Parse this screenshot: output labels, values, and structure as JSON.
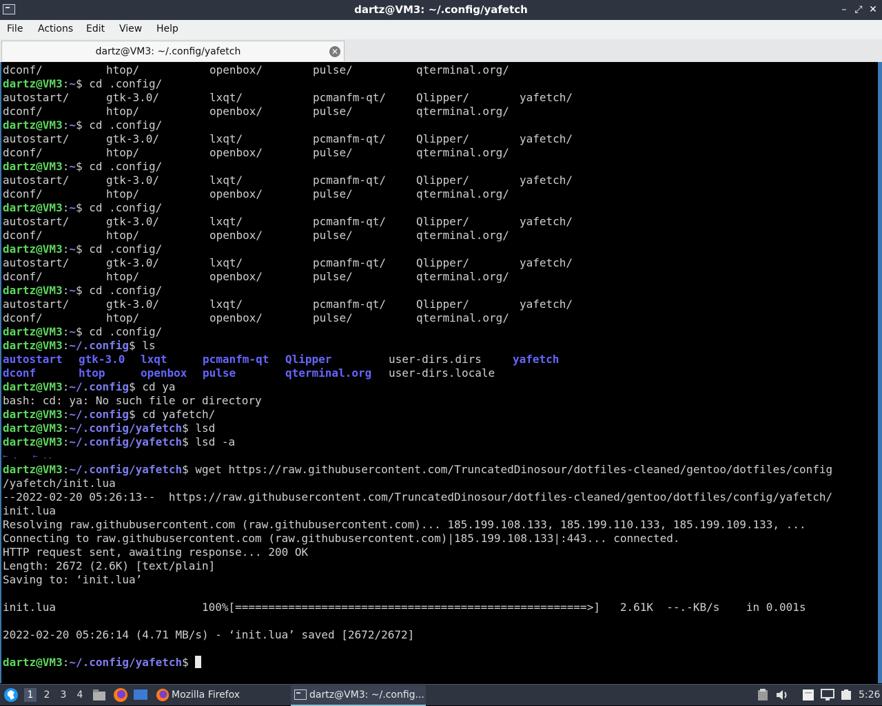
{
  "window": {
    "title": "dartz@VM3: ~/.config/yafetch"
  },
  "menu": [
    "File",
    "Actions",
    "Edit",
    "View",
    "Help"
  ],
  "tab": {
    "label": "dartz@VM3: ~/.config/yafetch"
  },
  "prompts": {
    "home": [
      "dartz@VM3",
      ":",
      "~",
      "$"
    ],
    "config": [
      "dartz@VM3",
      ":",
      "~/.config",
      "$"
    ],
    "yafetch": [
      "dartz@VM3",
      ":",
      "~/.config/yafetch",
      "$"
    ]
  },
  "terminal": {
    "lines": [
      {
        "t": "cols",
        "items": [
          "dconf/",
          "htop/",
          "openbox/",
          "pulse/",
          "qterminal.org/"
        ]
      },
      {
        "t": "prompt",
        "p": "home",
        "cmd": " cd .config/"
      },
      {
        "t": "cols",
        "items": [
          "autostart/",
          "gtk-3.0/",
          "lxqt/",
          "pcmanfm-qt/",
          "Qlipper/",
          "yafetch/"
        ]
      },
      {
        "t": "cols",
        "items": [
          "dconf/",
          "htop/",
          "openbox/",
          "pulse/",
          "qterminal.org/"
        ]
      },
      {
        "t": "prompt",
        "p": "home",
        "cmd": " cd .config/"
      },
      {
        "t": "cols",
        "items": [
          "autostart/",
          "gtk-3.0/",
          "lxqt/",
          "pcmanfm-qt/",
          "Qlipper/",
          "yafetch/"
        ]
      },
      {
        "t": "cols",
        "items": [
          "dconf/",
          "htop/",
          "openbox/",
          "pulse/",
          "qterminal.org/"
        ]
      },
      {
        "t": "prompt",
        "p": "home",
        "cmd": " cd .config/"
      },
      {
        "t": "cols",
        "items": [
          "autostart/",
          "gtk-3.0/",
          "lxqt/",
          "pcmanfm-qt/",
          "Qlipper/",
          "yafetch/"
        ]
      },
      {
        "t": "cols",
        "items": [
          "dconf/",
          "htop/",
          "openbox/",
          "pulse/",
          "qterminal.org/"
        ]
      },
      {
        "t": "prompt",
        "p": "home",
        "cmd": " cd .config/"
      },
      {
        "t": "cols",
        "items": [
          "autostart/",
          "gtk-3.0/",
          "lxqt/",
          "pcmanfm-qt/",
          "Qlipper/",
          "yafetch/"
        ]
      },
      {
        "t": "cols",
        "items": [
          "dconf/",
          "htop/",
          "openbox/",
          "pulse/",
          "qterminal.org/"
        ]
      },
      {
        "t": "prompt",
        "p": "home",
        "cmd": " cd .config/"
      },
      {
        "t": "cols",
        "items": [
          "autostart/",
          "gtk-3.0/",
          "lxqt/",
          "pcmanfm-qt/",
          "Qlipper/",
          "yafetch/"
        ]
      },
      {
        "t": "cols",
        "items": [
          "dconf/",
          "htop/",
          "openbox/",
          "pulse/",
          "qterminal.org/"
        ]
      },
      {
        "t": "prompt",
        "p": "home",
        "cmd": " cd .config/"
      },
      {
        "t": "cols",
        "items": [
          "autostart/",
          "gtk-3.0/",
          "lxqt/",
          "pcmanfm-qt/",
          "Qlipper/",
          "yafetch/"
        ]
      },
      {
        "t": "cols",
        "items": [
          "dconf/",
          "htop/",
          "openbox/",
          "pulse/",
          "qterminal.org/"
        ]
      },
      {
        "t": "prompt",
        "p": "home",
        "cmd": " cd .config/"
      },
      {
        "t": "prompt",
        "p": "config",
        "cmd": " ls"
      },
      {
        "t": "ls",
        "items": [
          {
            "s": "autostart",
            "d": true
          },
          {
            "s": "gtk-3.0",
            "d": true
          },
          {
            "s": "lxqt",
            "d": true
          },
          {
            "s": "pcmanfm-qt",
            "d": true
          },
          {
            "s": "Qlipper",
            "d": true
          },
          {
            "s": "user-dirs.dirs",
            "d": false
          },
          {
            "s": "yafetch",
            "d": true
          }
        ]
      },
      {
        "t": "ls",
        "items": [
          {
            "s": "dconf",
            "d": true
          },
          {
            "s": "htop",
            "d": true
          },
          {
            "s": "openbox",
            "d": true
          },
          {
            "s": "pulse",
            "d": true
          },
          {
            "s": "qterminal.org",
            "d": true
          },
          {
            "s": "user-dirs.locale",
            "d": false
          }
        ]
      },
      {
        "t": "prompt",
        "p": "config",
        "cmd": " cd ya"
      },
      {
        "t": "text",
        "s": "bash: cd: ya: No such file or directory"
      },
      {
        "t": "prompt",
        "p": "config",
        "cmd": " cd yafetch/"
      },
      {
        "t": "prompt",
        "p": "yafetch",
        "cmd": " lsd"
      },
      {
        "t": "prompt",
        "p": "yafetch",
        "cmd": " lsd -a"
      },
      {
        "t": "lsd",
        "s": "← .   ← .."
      },
      {
        "t": "prompt",
        "p": "yafetch",
        "cmd": " wget https://raw.githubusercontent.com/TruncatedDinosour/dotfiles-cleaned/gentoo/dotfiles/config"
      },
      {
        "t": "text",
        "s": "/yafetch/init.lua"
      },
      {
        "t": "text",
        "s": "--2022-02-20 05:26:13--  https://raw.githubusercontent.com/TruncatedDinosour/dotfiles-cleaned/gentoo/dotfiles/config/yafetch/"
      },
      {
        "t": "text",
        "s": "init.lua"
      },
      {
        "t": "text",
        "s": "Resolving raw.githubusercontent.com (raw.githubusercontent.com)... 185.199.108.133, 185.199.110.133, 185.199.109.133, ..."
      },
      {
        "t": "text",
        "s": "Connecting to raw.githubusercontent.com (raw.githubusercontent.com)|185.199.108.133|:443... connected."
      },
      {
        "t": "text",
        "s": "HTTP request sent, awaiting response... 200 OK"
      },
      {
        "t": "text",
        "s": "Length: 2672 (2.6K) [text/plain]"
      },
      {
        "t": "text",
        "s": "Saving to: ‘init.lua’"
      },
      {
        "t": "text",
        "s": ""
      },
      {
        "t": "text",
        "s": "init.lua                      100%[=====================================================>]   2.61K  --.-KB/s    in 0.001s"
      },
      {
        "t": "text",
        "s": ""
      },
      {
        "t": "text",
        "s": "2022-02-20 05:26:14 (4.71 MB/s) - ‘init.lua’ saved [2672/2672]"
      },
      {
        "t": "text",
        "s": ""
      },
      {
        "t": "prompt",
        "p": "yafetch",
        "cmd": " ",
        "cursor": true
      }
    ]
  },
  "taskbar": {
    "workspaces": [
      "1",
      "2",
      "3",
      "4"
    ],
    "active_workspace": "1",
    "tasks": [
      {
        "label": "Mozilla Firefox",
        "icon": "firefox-icon",
        "active": false
      },
      {
        "label": "dartz@VM3: ~/.config...",
        "icon": "terminal-icon",
        "active": true
      }
    ],
    "clock": "5:26"
  }
}
